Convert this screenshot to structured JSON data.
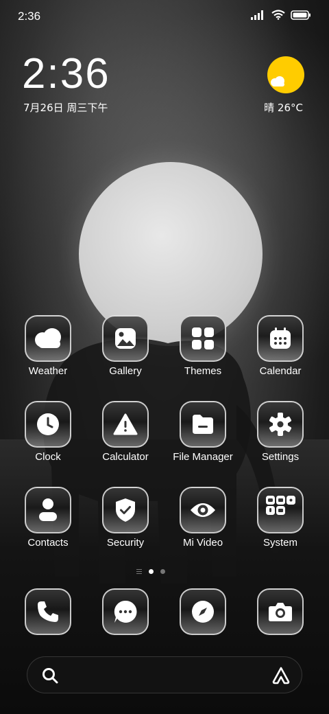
{
  "status_bar": {
    "time": "2:36"
  },
  "clock_widget": {
    "time": "2:36",
    "date": "7月26日 周三下午"
  },
  "weather_widget": {
    "text": "晴 26°C",
    "icon": "sunny-partly-cloudy-icon",
    "sun_color": "#ffcc00"
  },
  "apps": [
    {
      "label": "Weather",
      "icon": "weather-icon"
    },
    {
      "label": "Gallery",
      "icon": "gallery-icon"
    },
    {
      "label": "Themes",
      "icon": "themes-icon"
    },
    {
      "label": "Calendar",
      "icon": "calendar-icon"
    },
    {
      "label": "Clock",
      "icon": "clock-icon"
    },
    {
      "label": "Calculator",
      "icon": "calculator-icon"
    },
    {
      "label": "File Manager",
      "icon": "file-manager-icon"
    },
    {
      "label": "Settings",
      "icon": "settings-icon"
    },
    {
      "label": "Contacts",
      "icon": "contacts-icon"
    },
    {
      "label": "Security",
      "icon": "security-icon"
    },
    {
      "label": "Mi Video",
      "icon": "mi-video-icon"
    },
    {
      "label": "System",
      "icon": "system-folder-icon"
    }
  ],
  "dock": [
    {
      "icon": "phone-icon"
    },
    {
      "icon": "messages-icon"
    },
    {
      "icon": "browser-icon"
    },
    {
      "icon": "camera-icon"
    }
  ]
}
